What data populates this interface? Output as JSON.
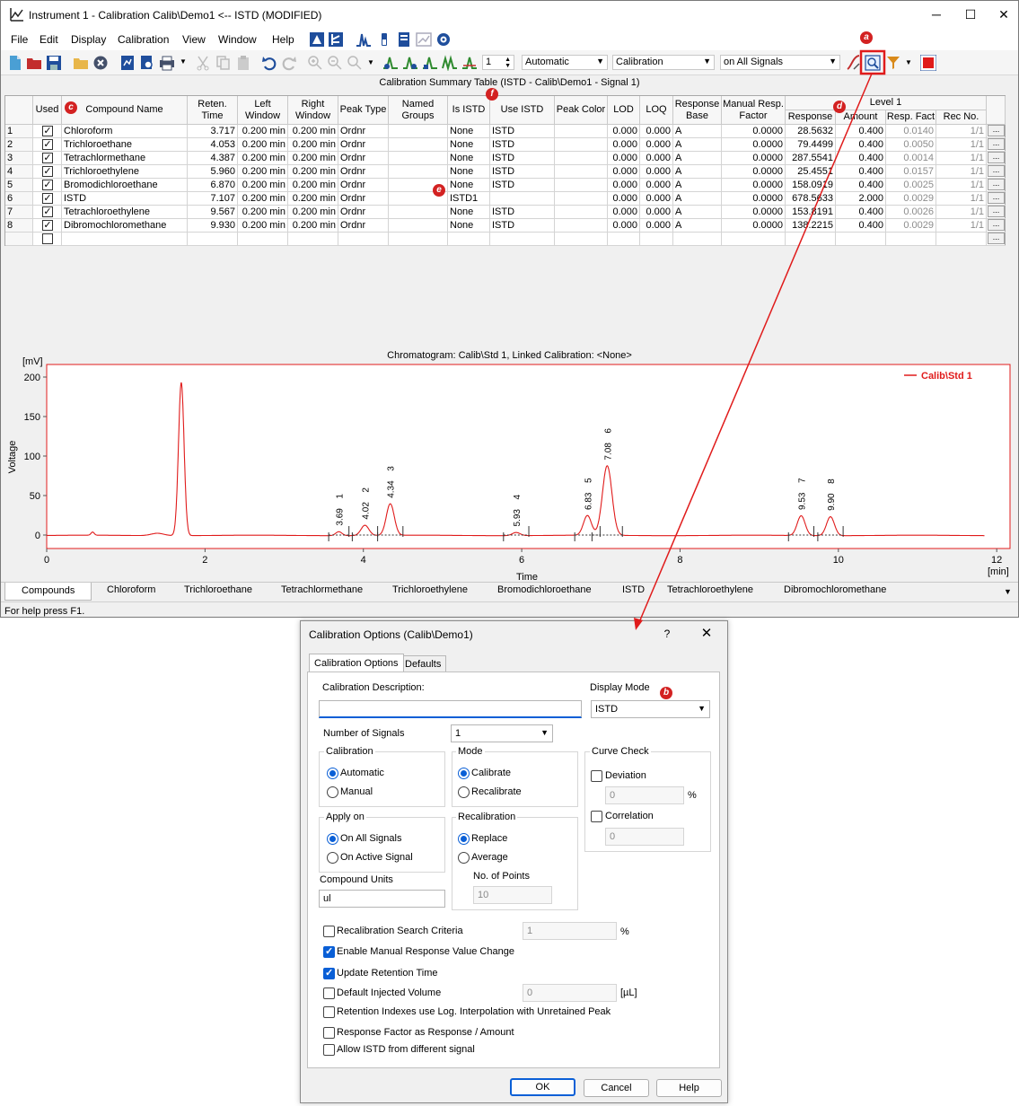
{
  "window": {
    "title": "Instrument 1 - Calibration Calib\\Demo1 <-- ISTD (MODIFIED)",
    "minimize": "─",
    "maximize": "☐",
    "close": "✕"
  },
  "menu": [
    "File",
    "Edit",
    "Display",
    "Calibration",
    "View",
    "Window",
    "Help"
  ],
  "toolbar": {
    "spinner_value": "1",
    "mode_select": "Automatic",
    "type_select": "Calibration",
    "signals_select": "on All Signals"
  },
  "table": {
    "title": "Calibration Summary Table (ISTD - Calib\\Demo1 - Signal 1)",
    "headers": {
      "used": "Used",
      "compound_name": "Compound Name",
      "reten_time": "Reten. Time",
      "left_window": "Left Window",
      "right_window": "Right Window",
      "peak_type": "Peak Type",
      "named_groups": "Named Groups",
      "is_istd": "Is ISTD",
      "use_istd": "Use ISTD",
      "peak_color": "Peak Color",
      "lod": "LOD",
      "loq": "LOQ",
      "response_base": "Response Base",
      "manual_resp_factor": "Manual Resp. Factor",
      "level": "Level 1",
      "response": "Response",
      "amount": "Amount",
      "resp_fact": "Resp. Fact",
      "rec_no": "Rec No."
    },
    "rows": [
      {
        "no": "1",
        "used": true,
        "name": "Chloroform",
        "rt": "3.717",
        "lw": "0.200 min",
        "rw": "0.200 min",
        "pt": "Ordnr",
        "ng": "",
        "is_istd": "None",
        "use_istd": "ISTD",
        "lod": "0.000",
        "loq": "0.000",
        "base": "A",
        "mrf": "0.0000",
        "response": "28.5632",
        "amount": "0.400",
        "rf": "0.0140",
        "rec": "1/1"
      },
      {
        "no": "2",
        "used": true,
        "name": "Trichloroethane",
        "rt": "4.053",
        "lw": "0.200 min",
        "rw": "0.200 min",
        "pt": "Ordnr",
        "ng": "",
        "is_istd": "None",
        "use_istd": "ISTD",
        "lod": "0.000",
        "loq": "0.000",
        "base": "A",
        "mrf": "0.0000",
        "response": "79.4499",
        "amount": "0.400",
        "rf": "0.0050",
        "rec": "1/1"
      },
      {
        "no": "3",
        "used": true,
        "name": "Tetrachlormethane",
        "rt": "4.387",
        "lw": "0.200 min",
        "rw": "0.200 min",
        "pt": "Ordnr",
        "ng": "",
        "is_istd": "None",
        "use_istd": "ISTD",
        "lod": "0.000",
        "loq": "0.000",
        "base": "A",
        "mrf": "0.0000",
        "response": "287.5541",
        "amount": "0.400",
        "rf": "0.0014",
        "rec": "1/1"
      },
      {
        "no": "4",
        "used": true,
        "name": "Trichloroethylene",
        "rt": "5.960",
        "lw": "0.200 min",
        "rw": "0.200 min",
        "pt": "Ordnr",
        "ng": "",
        "is_istd": "None",
        "use_istd": "ISTD",
        "lod": "0.000",
        "loq": "0.000",
        "base": "A",
        "mrf": "0.0000",
        "response": "25.4551",
        "amount": "0.400",
        "rf": "0.0157",
        "rec": "1/1"
      },
      {
        "no": "5",
        "used": true,
        "name": "Bromodichloroethane",
        "rt": "6.870",
        "lw": "0.200 min",
        "rw": "0.200 min",
        "pt": "Ordnr",
        "ng": "",
        "is_istd": "None",
        "use_istd": "ISTD",
        "lod": "0.000",
        "loq": "0.000",
        "base": "A",
        "mrf": "0.0000",
        "response": "158.0919",
        "amount": "0.400",
        "rf": "0.0025",
        "rec": "1/1"
      },
      {
        "no": "6",
        "used": true,
        "name": "ISTD",
        "rt": "7.107",
        "lw": "0.200 min",
        "rw": "0.200 min",
        "pt": "Ordnr",
        "ng": "",
        "is_istd": "ISTD1",
        "use_istd": "",
        "lod": "0.000",
        "loq": "0.000",
        "base": "A",
        "mrf": "0.0000",
        "response": "678.5633",
        "amount": "2.000",
        "rf": "0.0029",
        "rec": "1/1"
      },
      {
        "no": "7",
        "used": true,
        "name": "Tetrachloroethylene",
        "rt": "9.567",
        "lw": "0.200 min",
        "rw": "0.200 min",
        "pt": "Ordnr",
        "ng": "",
        "is_istd": "None",
        "use_istd": "ISTD",
        "lod": "0.000",
        "loq": "0.000",
        "base": "A",
        "mrf": "0.0000",
        "response": "153.8191",
        "amount": "0.400",
        "rf": "0.0026",
        "rec": "1/1"
      },
      {
        "no": "8",
        "used": true,
        "name": "Dibromochloromethane",
        "rt": "9.930",
        "lw": "0.200 min",
        "rw": "0.200 min",
        "pt": "Ordnr",
        "ng": "",
        "is_istd": "None",
        "use_istd": "ISTD",
        "lod": "0.000",
        "loq": "0.000",
        "base": "A",
        "mrf": "0.0000",
        "response": "138.2215",
        "amount": "0.400",
        "rf": "0.0029",
        "rec": "1/1"
      }
    ],
    "row_button": "..."
  },
  "chromatogram": {
    "title": "Chromatogram: Calib\\Std 1, Linked Calibration: <None>",
    "legend": "Calib\\Std 1",
    "y_unit": "[mV]",
    "x_unit": "[min]",
    "ylabel": "Voltage",
    "xlabel": "Time",
    "x_ticks": [
      "0",
      "2",
      "4",
      "6",
      "8",
      "10",
      "12"
    ],
    "y_ticks": [
      "0",
      "50",
      "100",
      "150",
      "200"
    ]
  },
  "chart_data": {
    "type": "line",
    "title": "Chromatogram: Calib\\Std 1, Linked Calibration: <None>",
    "xlabel": "Time",
    "ylabel": "Voltage",
    "x_unit": "[min]",
    "y_unit": "[mV]",
    "xlim": [
      0,
      12.3
    ],
    "ylim": [
      -5,
      210
    ],
    "series": [
      {
        "name": "Calib\\Std 1",
        "color": "#e01b1b"
      }
    ],
    "peaks": [
      {
        "label": "",
        "rt": 0.58,
        "height": 4,
        "width": 0.02
      },
      {
        "label": "",
        "rt": 1.4,
        "height": 3,
        "width": 0.08
      },
      {
        "label": "",
        "rt": 1.7,
        "height": 194,
        "width": 0.035
      },
      {
        "label": "1",
        "rt_label": "3.69",
        "rt": 3.69,
        "height": 5,
        "width": 0.04
      },
      {
        "label": "2",
        "rt_label": "4.02",
        "rt": 4.02,
        "height": 13,
        "width": 0.05
      },
      {
        "label": "3",
        "rt_label": "4.34",
        "rt": 4.34,
        "height": 40,
        "width": 0.05
      },
      {
        "label": "4",
        "rt_label": "5.93",
        "rt": 5.93,
        "height": 4,
        "width": 0.05
      },
      {
        "label": "5",
        "rt_label": "6.83",
        "rt": 6.83,
        "height": 25,
        "width": 0.05
      },
      {
        "label": "6",
        "rt_label": "7.08",
        "rt": 7.08,
        "height": 88,
        "width": 0.06
      },
      {
        "label": "7",
        "rt_label": "9.53",
        "rt": 9.53,
        "height": 25,
        "width": 0.05
      },
      {
        "label": "8",
        "rt_label": "9.90",
        "rt": 9.9,
        "height": 24,
        "width": 0.05
      }
    ],
    "grid": false,
    "legend_position": "top-right"
  },
  "tabs": [
    "Compounds",
    "Chloroform",
    "Trichloroethane",
    "Tetrachlormethane",
    "Trichloroethylene",
    "Bromodichloroethane",
    "ISTD",
    "Tetrachloroethylene",
    "Dibromochloromethane"
  ],
  "status": "For help press F1.",
  "badges": {
    "a": "a",
    "b": "b",
    "c": "c",
    "d": "d",
    "e": "e",
    "f": "f"
  },
  "dialog": {
    "title": "Calibration Options (Calib\\Demo1)",
    "help": "?",
    "close": "✕",
    "tabs": [
      "Calibration Options",
      "Defaults"
    ],
    "calib_desc_label": "Calibration Description:",
    "calib_desc_value": "",
    "display_mode_label": "Display Mode",
    "display_mode_value": "ISTD",
    "num_signals_label": "Number of Signals",
    "num_signals_value": "1",
    "calibration_group": "Calibration",
    "calibration_opts": [
      "Automatic",
      "Manual"
    ],
    "mode_group": "Mode",
    "mode_opts": [
      "Calibrate",
      "Recalibrate"
    ],
    "curve_check_group": "Curve Check",
    "deviation_label": "Deviation",
    "deviation_value": "0",
    "percent": "%",
    "correlation_label": "Correlation",
    "correlation_value": "0",
    "apply_on_group": "Apply on",
    "apply_opts": [
      "On All Signals",
      "On Active Signal"
    ],
    "recalibration_group": "Recalibration",
    "recal_opts": [
      "Replace",
      "Average"
    ],
    "num_points_label": "No. of Points",
    "num_points_value": "10",
    "compound_units_label": "Compound Units",
    "compound_units_value": "ul",
    "recal_search_label": "Recalibration Search Criteria",
    "recal_search_value": "1",
    "enable_manual_label": "Enable Manual Response Value Change",
    "update_rt_label": "Update Retention Time",
    "default_inj_label": "Default Injected Volume",
    "default_inj_value": "0",
    "ul_unit": "[µL]",
    "ri_label": "Retention Indexes use Log. Interpolation with Unretained Peak",
    "rf_label": "Response Factor as Response / Amount",
    "allow_istd_label": "Allow ISTD from different signal",
    "ok": "OK",
    "cancel": "Cancel",
    "help_btn": "Help"
  },
  "colors": {
    "accent": "#0a5fd6",
    "annotation": "#e01b1b",
    "trace": "#e01b1b"
  }
}
